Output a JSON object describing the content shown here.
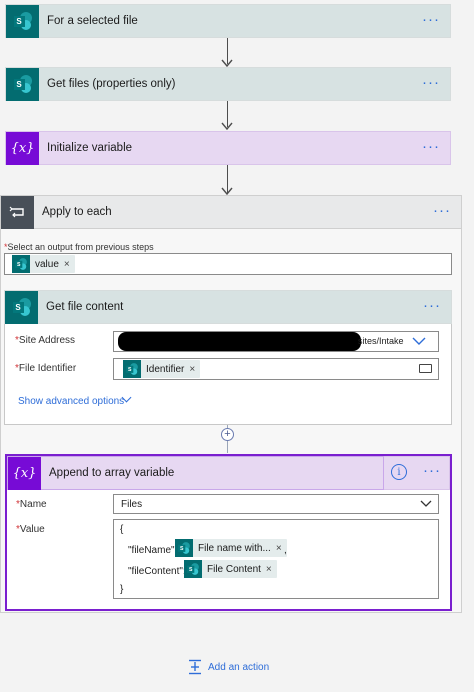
{
  "steps": {
    "for_selected_file": {
      "title": "For a selected file"
    },
    "get_files": {
      "title": "Get files (properties only)"
    },
    "init_variable": {
      "title": "Initialize variable"
    },
    "apply_each": {
      "title": "Apply to each",
      "output_label": "Select an output from previous steps",
      "output_token": "value"
    },
    "get_file_content": {
      "title": "Get file content",
      "site_label": "Site Address",
      "site_value_suffix": "sites/Intake",
      "file_id_label": "File Identifier",
      "file_id_token": "Identifier",
      "advanced_link": "Show advanced options"
    },
    "append_array": {
      "title": "Append to array variable",
      "name_label": "Name",
      "name_value": "Files",
      "value_label": "Value",
      "brace_open": "{",
      "brace_close": "}",
      "key1": "\"fileName\":",
      "token1": "File name with...",
      "comma": ",",
      "key2": "\"fileContent\":",
      "token2": "File Content"
    }
  },
  "common": {
    "more_dots": "···",
    "required_mark": "*",
    "close_x": "×",
    "var_symbol": "{x}",
    "info_symbol": "i"
  },
  "footer": {
    "add_action": "Add an action"
  },
  "colors": {
    "sharepoint": "#036c70",
    "variable": "#770bd6",
    "accent": "#2e6dd8"
  }
}
